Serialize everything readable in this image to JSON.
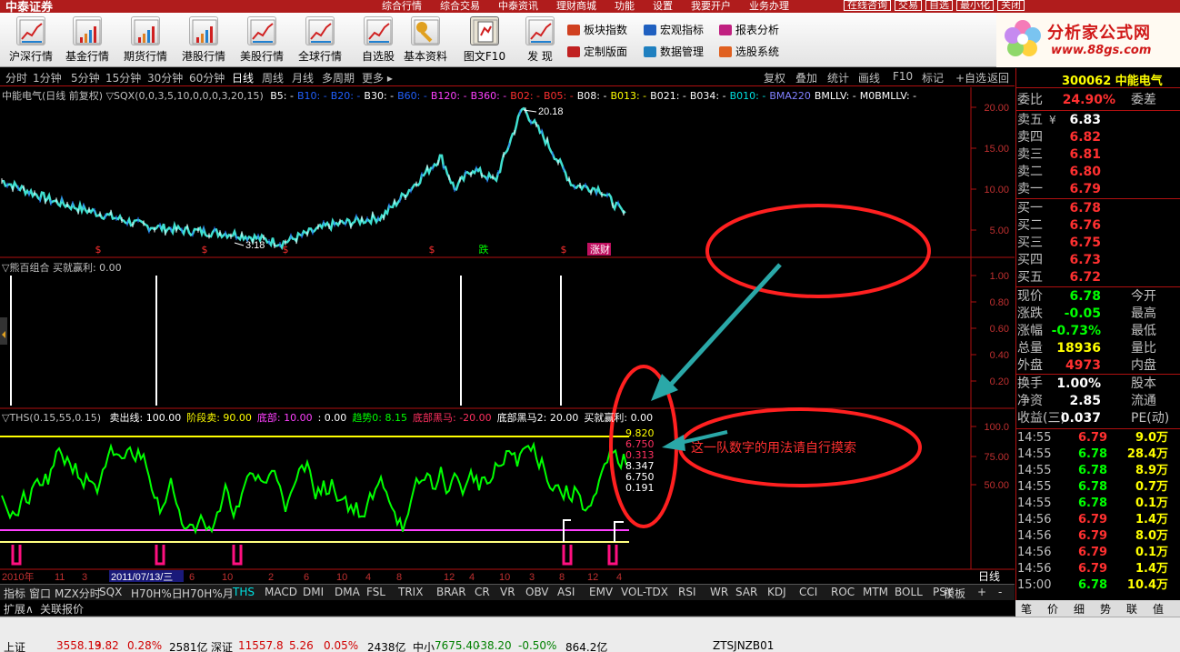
{
  "top_menu": {
    "logo": "中泰证券",
    "items": [
      "综合行情",
      "综合交易",
      "中泰资讯",
      "理财商城",
      "功能",
      "设置",
      "我要开户",
      "业务办理"
    ],
    "right": [
      "在线咨询",
      "交易",
      "自选",
      "最小化",
      "关闭"
    ]
  },
  "toolbar": {
    "buttons": [
      {
        "label": "沪深行情",
        "icon": "line-chart-icon"
      },
      {
        "label": "基金行情",
        "icon": "bar-chart-icon"
      },
      {
        "label": "期货行情",
        "icon": "bar-chart-icon"
      },
      {
        "label": "港股行情",
        "icon": "candle-chart-icon"
      },
      {
        "label": "美股行情",
        "icon": "trend-chart-icon"
      },
      {
        "label": "全球行情",
        "icon": "globe-chart-icon"
      },
      {
        "label": "自选股",
        "icon": "magnifier-chart-icon"
      },
      {
        "label": "基本资料",
        "icon": "key-icon"
      },
      {
        "label": "图文F10",
        "icon": "document-icon"
      },
      {
        "label": "发  现",
        "icon": "discover-chart-icon"
      }
    ],
    "links": [
      "板块指数",
      "宏观指标",
      "报表分析",
      "定制版面",
      "数据管理",
      "选股系统"
    ]
  },
  "brand": {
    "name": "分析家公式网",
    "url": "www.88gs.com"
  },
  "period_bar": {
    "periods": [
      "分时",
      "1分钟",
      "5分钟",
      "15分钟",
      "30分钟",
      "60分钟",
      "日线",
      "周线",
      "月线",
      "多周期",
      "更多"
    ],
    "active": "日线",
    "right": [
      "复权",
      "叠加",
      "统计",
      "画线",
      "F10",
      "标记",
      "+自选",
      "返回"
    ]
  },
  "main_pane": {
    "title": "中能电气(日线 前复权) ▽SQX(0,0,3,5,10,0,0,0,3,20,15)",
    "legend": [
      "B5: -",
      "B10: -",
      "B20: -",
      "B30: -",
      "B60: -",
      "B120: -",
      "B360: -",
      "B02: -",
      "B05: -",
      "B08: -",
      "B013: -",
      "B021: -",
      "B034: -",
      "B010: -",
      "BMA220",
      "BMLLV: -",
      "M0BMLLV: -"
    ],
    "y_ticks": [
      "20.00",
      "15.00",
      "10.00",
      "5.00"
    ],
    "high_label": "20.18",
    "low_label": "3.18",
    "markers": [
      "$",
      "$",
      "$",
      "$",
      "跌",
      "$",
      "涨财"
    ]
  },
  "pane2": {
    "title": "▽熊百组合 买就赢利: 0.00",
    "y_ticks": [
      "1.00",
      "0.80",
      "0.60",
      "0.40",
      "0.20"
    ]
  },
  "pane3": {
    "title_prefix": "▽THS(0.15,55,0.15)",
    "title_items": [
      {
        "text": "卖出线: 100.00",
        "color": "#ffffff"
      },
      {
        "text": "阶段卖: 90.00",
        "color": "#ffff00"
      },
      {
        "text": "底部: 10.00",
        "color": "#ff40ff"
      },
      {
        "text": ": 0.00",
        "color": "#ffffff"
      },
      {
        "text": "趋势0: 8.15",
        "color": "#00ff00"
      },
      {
        "text": "底部黑马: -20.00",
        "color": "#ff3060"
      },
      {
        "text": "底部黑马2: 20.00",
        "color": "#ffffff"
      },
      {
        "text": "买就赢利: 0.00",
        "color": "#ffffff"
      }
    ],
    "y_ticks": [
      "100.0",
      "75.00",
      "50.00"
    ],
    "values": [
      {
        "text": "9.820",
        "color": "#ffff00"
      },
      {
        "text": "6.750",
        "color": "#ff3060"
      },
      {
        "text": "0.313",
        "color": "#ff3060"
      },
      {
        "text": "8.347",
        "color": "#ffffff"
      },
      {
        "text": "6.750",
        "color": "#ffffff"
      },
      {
        "text": "0.191",
        "color": "#ffffff"
      }
    ]
  },
  "x_axis": {
    "labels": [
      "2010年",
      "11",
      "3",
      "2011/07/13/三",
      "6",
      "10",
      "2",
      "6",
      "10",
      "4",
      "8",
      "12",
      "4",
      "10",
      "3",
      "8",
      "12",
      "4",
      "8",
      "12"
    ],
    "unit": "日线"
  },
  "annotation": {
    "text": "这一队数字的用法请自行摸索"
  },
  "quote": {
    "code": "300062 中能电气",
    "weibi_label": "委比",
    "weibi_value": "24.90%",
    "weicha_label": "委差",
    "asks": [
      {
        "label": "卖五",
        "price": "6.83",
        "mark": "¥"
      },
      {
        "label": "卖四",
        "price": "6.82"
      },
      {
        "label": "卖三",
        "price": "6.81"
      },
      {
        "label": "卖二",
        "price": "6.80"
      },
      {
        "label": "卖一",
        "price": "6.79"
      }
    ],
    "bids": [
      {
        "label": "买一",
        "price": "6.78"
      },
      {
        "label": "买二",
        "price": "6.76"
      },
      {
        "label": "买三",
        "price": "6.75"
      },
      {
        "label": "买四",
        "price": "6.73"
      },
      {
        "label": "买五",
        "price": "6.72"
      }
    ],
    "stats": [
      {
        "label": "现价",
        "value": "6.78",
        "color": "#00ff00",
        "label2": "今开"
      },
      {
        "label": "涨跌",
        "value": "-0.05",
        "color": "#00ff00",
        "label2": "最高"
      },
      {
        "label": "涨幅",
        "value": "-0.73%",
        "color": "#00ff00",
        "label2": "最低"
      },
      {
        "label": "总量",
        "value": "18936",
        "color": "#ffff00",
        "label2": "量比"
      },
      {
        "label": "外盘",
        "value": "4973",
        "color": "#ff3030",
        "label2": "内盘"
      }
    ],
    "stats2": [
      {
        "label": "换手",
        "value": "1.00%",
        "label2": "股本"
      },
      {
        "label": "净资",
        "value": "2.85",
        "label2": "流通"
      },
      {
        "label": "收益(三)",
        "value": "0.037",
        "label2": "PE(动)"
      }
    ],
    "ticks": [
      {
        "time": "14:55",
        "price": "6.79",
        "vol": "9.0万"
      },
      {
        "time": "14:55",
        "price": "6.78",
        "vol": "28.4万"
      },
      {
        "time": "14:55",
        "price": "6.78",
        "vol": "8.9万"
      },
      {
        "time": "14:55",
        "price": "6.78",
        "vol": "0.7万"
      },
      {
        "time": "14:55",
        "price": "6.78",
        "vol": "0.1万"
      },
      {
        "time": "14:56",
        "price": "6.79",
        "vol": "1.4万"
      },
      {
        "time": "14:56",
        "price": "6.79",
        "vol": "8.0万"
      },
      {
        "time": "14:56",
        "price": "6.79",
        "vol": "0.1万"
      },
      {
        "time": "14:56",
        "price": "6.79",
        "vol": "1.4万"
      },
      {
        "time": "15:00",
        "price": "6.78",
        "vol": "10.4万"
      }
    ],
    "tabs": [
      "笔",
      "价",
      "细",
      "势",
      "联",
      "值"
    ]
  },
  "tab_bar": {
    "items": [
      "指标",
      "窗口",
      "MZX分时",
      "SQX",
      "H70H%日",
      "H70H%月",
      "THS",
      "MACD",
      "DMI",
      "DMA",
      "FSL",
      "TRIX",
      "BRAR",
      "CR",
      "VR",
      "OBV",
      "ASI",
      "EMV",
      "VOL-TDX",
      "RSI",
      "WR",
      "SAR",
      "KDJ",
      "CCI",
      "ROC",
      "MTM",
      "BOLL",
      "PSY"
    ],
    "active": "THS",
    "right": [
      "模板",
      "+",
      "-"
    ]
  },
  "sub_bar": {
    "items": [
      "扩展∧",
      "关联报价"
    ]
  },
  "status_bar": {
    "items": [
      {
        "text": "上证",
        "cls": "blk"
      },
      {
        "text": "3558.13",
        "cls": "red"
      },
      {
        "text": "9.82",
        "cls": "red"
      },
      {
        "text": "0.28%",
        "cls": "red"
      },
      {
        "text": "2581亿",
        "cls": "blk"
      },
      {
        "text": "深证",
        "cls": "blk"
      },
      {
        "text": "11557.8",
        "cls": "red"
      },
      {
        "text": "5.26",
        "cls": "red"
      },
      {
        "text": "0.05%",
        "cls": "red"
      },
      {
        "text": "2438亿",
        "cls": "blk"
      },
      {
        "text": "中小",
        "cls": "blk"
      },
      {
        "text": "7675.40",
        "cls": "grn"
      },
      {
        "text": "-38.20",
        "cls": "grn"
      },
      {
        "text": "-0.50%",
        "cls": "grn"
      },
      {
        "text": "864.2亿",
        "cls": "blk"
      },
      {
        "text": "ZTSJNZB01",
        "cls": "blk"
      }
    ]
  },
  "colors": {
    "up": "#ff3030",
    "down": "#00ff00",
    "grid": "#b01010",
    "kline": "#40e0d0",
    "ths": "#00ff00",
    "magenta": "#ff40ff"
  }
}
